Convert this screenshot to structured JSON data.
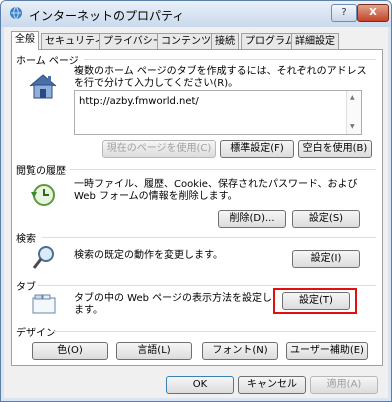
{
  "window": {
    "title": "インターネットのプロパティ",
    "help_label": "?",
    "close_label": "X"
  },
  "tabs": [
    {
      "label": "全般",
      "active": true
    },
    {
      "label": "セキュリティ"
    },
    {
      "label": "プライバシー"
    },
    {
      "label": "コンテンツ"
    },
    {
      "label": "接続"
    },
    {
      "label": "プログラム"
    },
    {
      "label": "詳細設定"
    }
  ],
  "home_page": {
    "group_label": "ホーム ページ",
    "description": "複数のホーム ページのタブを作成するには、それぞれのアドレスを行で分けて入力してください(R)。",
    "url": "http://azby.fmworld.net/",
    "use_current_label": "現在のページを使用(C)",
    "use_default_label": "標準設定(F)",
    "use_blank_label": "空白を使用(B)"
  },
  "history": {
    "group_label": "閲覧の履歴",
    "description": "一時ファイル、履歴、Cookie、保存されたパスワード、および Web フォームの情報を削除します。",
    "delete_label": "削除(D)...",
    "settings_label": "設定(S)"
  },
  "search": {
    "group_label": "検索",
    "description": "検索の既定の動作を変更します。",
    "settings_label": "設定(I)"
  },
  "tabs_section": {
    "group_label": "タブ",
    "description": "タブの中の Web ページの表示方法を設定します。",
    "settings_label": "設定(T)"
  },
  "design": {
    "group_label": "デザイン",
    "colors_label": "色(O)",
    "languages_label": "言語(L)",
    "fonts_label": "フォント(N)",
    "accessibility_label": "ユーザー補助(E)"
  },
  "footer": {
    "ok_label": "OK",
    "cancel_label": "キャンセル",
    "apply_label": "適用(A)"
  },
  "colors": {
    "highlight": "#e01010"
  }
}
